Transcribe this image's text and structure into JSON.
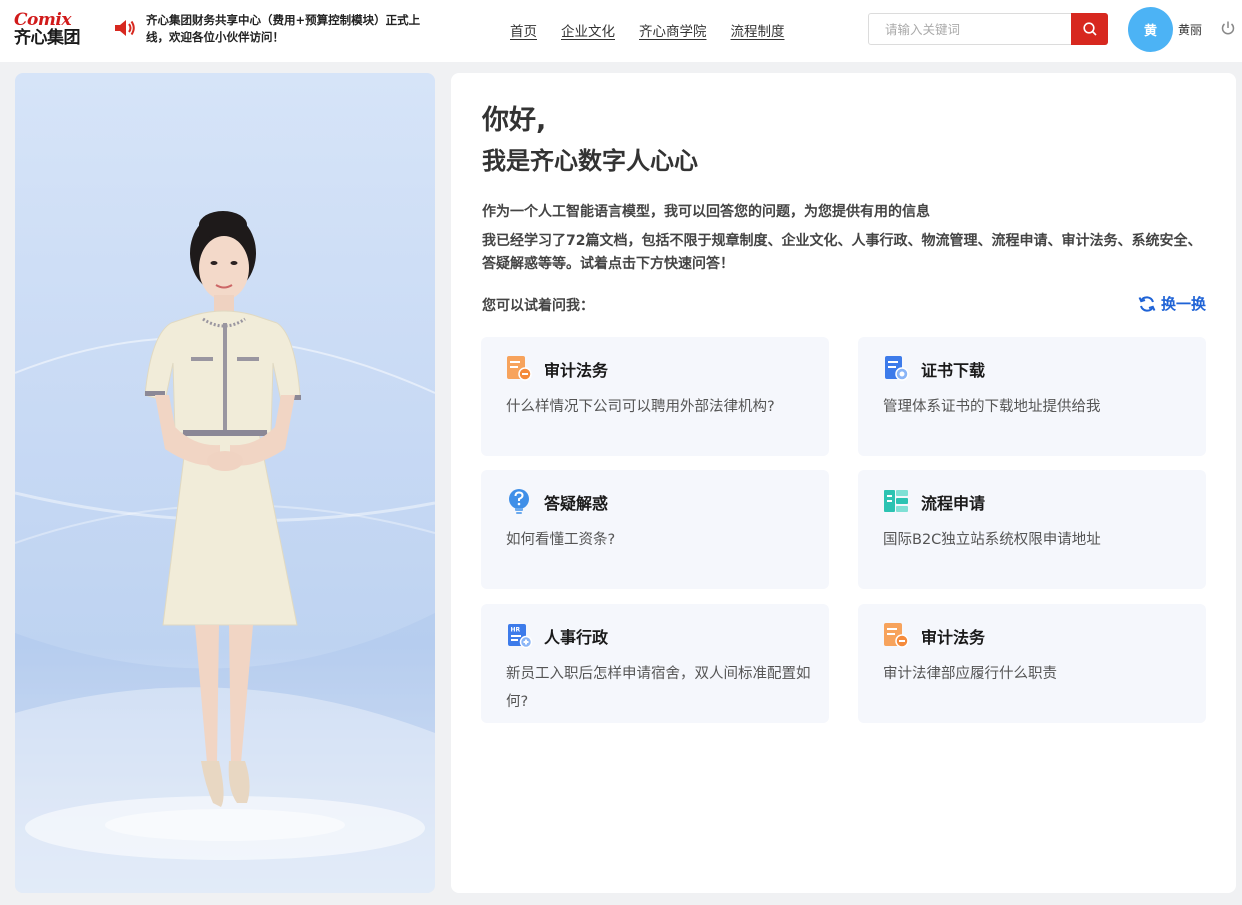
{
  "header": {
    "logo_en": "Comix",
    "logo_cn": "齐心集团",
    "notice": "齐心集团财务共享中心（费用+预算控制模块）正式上线，欢迎各位小伙伴访问！",
    "nav": [
      "首页",
      "企业文化",
      "齐心商学院",
      "流程制度"
    ],
    "search_placeholder": "请输入关键词",
    "avatar_text": "黄",
    "username": "黄丽"
  },
  "icons": {
    "speaker": "speaker-icon",
    "search": "search-icon",
    "power": "power-icon",
    "refresh": "refresh-icon"
  },
  "colors": {
    "brand_red": "#d7281f",
    "accent_blue": "#1f63d6",
    "avatar_blue": "#4cb3f5",
    "card_bg": "#f5f7fc"
  },
  "main": {
    "greet1": "你好,",
    "greet2": "我是齐心数字人心心",
    "intro1": "作为一个人工智能语言模型，我可以回答您的问题，为您提供有用的信息",
    "intro2": "我已经学习了72篇文档，包括不限于规章制度、企业文化、人事行政、物流管理、流程申请、审计法务、系统安全、答疑解惑等等。试着点击下方快速问答！",
    "try_label": "您可以试着问我：",
    "refresh_label": "换一换",
    "cards": [
      {
        "title": "审计法务",
        "question": "什么样情况下公司可以聘用外部法律机构?",
        "icon": "audit-law-icon"
      },
      {
        "title": "证书下载",
        "question": "管理体系证书的下载地址提供给我",
        "icon": "certificate-icon"
      },
      {
        "title": "答疑解惑",
        "question": "如何看懂工资条?",
        "icon": "question-bulb-icon"
      },
      {
        "title": "流程申请",
        "question": "国际B2C独立站系统权限申请地址",
        "icon": "process-icon"
      },
      {
        "title": "人事行政",
        "question": "新员工入职后怎样申请宿舍，双人间标准配置如何?",
        "icon": "hr-icon"
      },
      {
        "title": "审计法务",
        "question": "审计法律部应履行什么职责",
        "icon": "audit-law-icon"
      }
    ]
  }
}
